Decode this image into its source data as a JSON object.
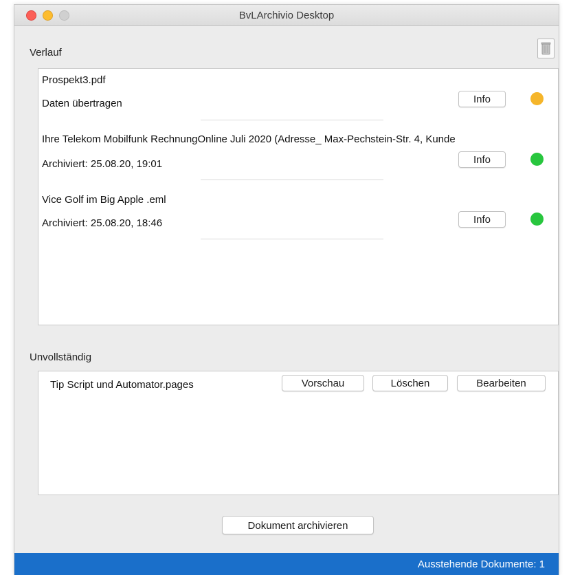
{
  "window": {
    "title": "BvLArchivio Desktop"
  },
  "verlauf": {
    "label": "Verlauf",
    "items": [
      {
        "name": "Prospekt3.pdf",
        "status": "Daten übertragen",
        "info_label": "Info",
        "dot_color": "#f5b52a"
      },
      {
        "name": "Ihre Telekom Mobilfunk RechnungOnline Juli 2020 (Adresse_ Max-Pechstein-Str. 4, Kunde",
        "status": "Archiviert: 25.08.20, 19:01",
        "info_label": "Info",
        "dot_color": "#28c63e"
      },
      {
        "name": "Vice Golf im Big Apple .eml",
        "status": "Archiviert: 25.08.20, 18:46",
        "info_label": "Info",
        "dot_color": "#28c63e"
      }
    ]
  },
  "unvollstaendig": {
    "label": "Unvollständig",
    "items": [
      {
        "name": "Tip Script und Automator.pages",
        "preview_label": "Vorschau",
        "delete_label": "Löschen",
        "edit_label": "Bearbeiten"
      }
    ]
  },
  "archive_button": "Dokument archivieren",
  "statusbar": {
    "text": "Ausstehende Dokumente:  1"
  },
  "icons": {
    "trash": "trash-icon"
  }
}
